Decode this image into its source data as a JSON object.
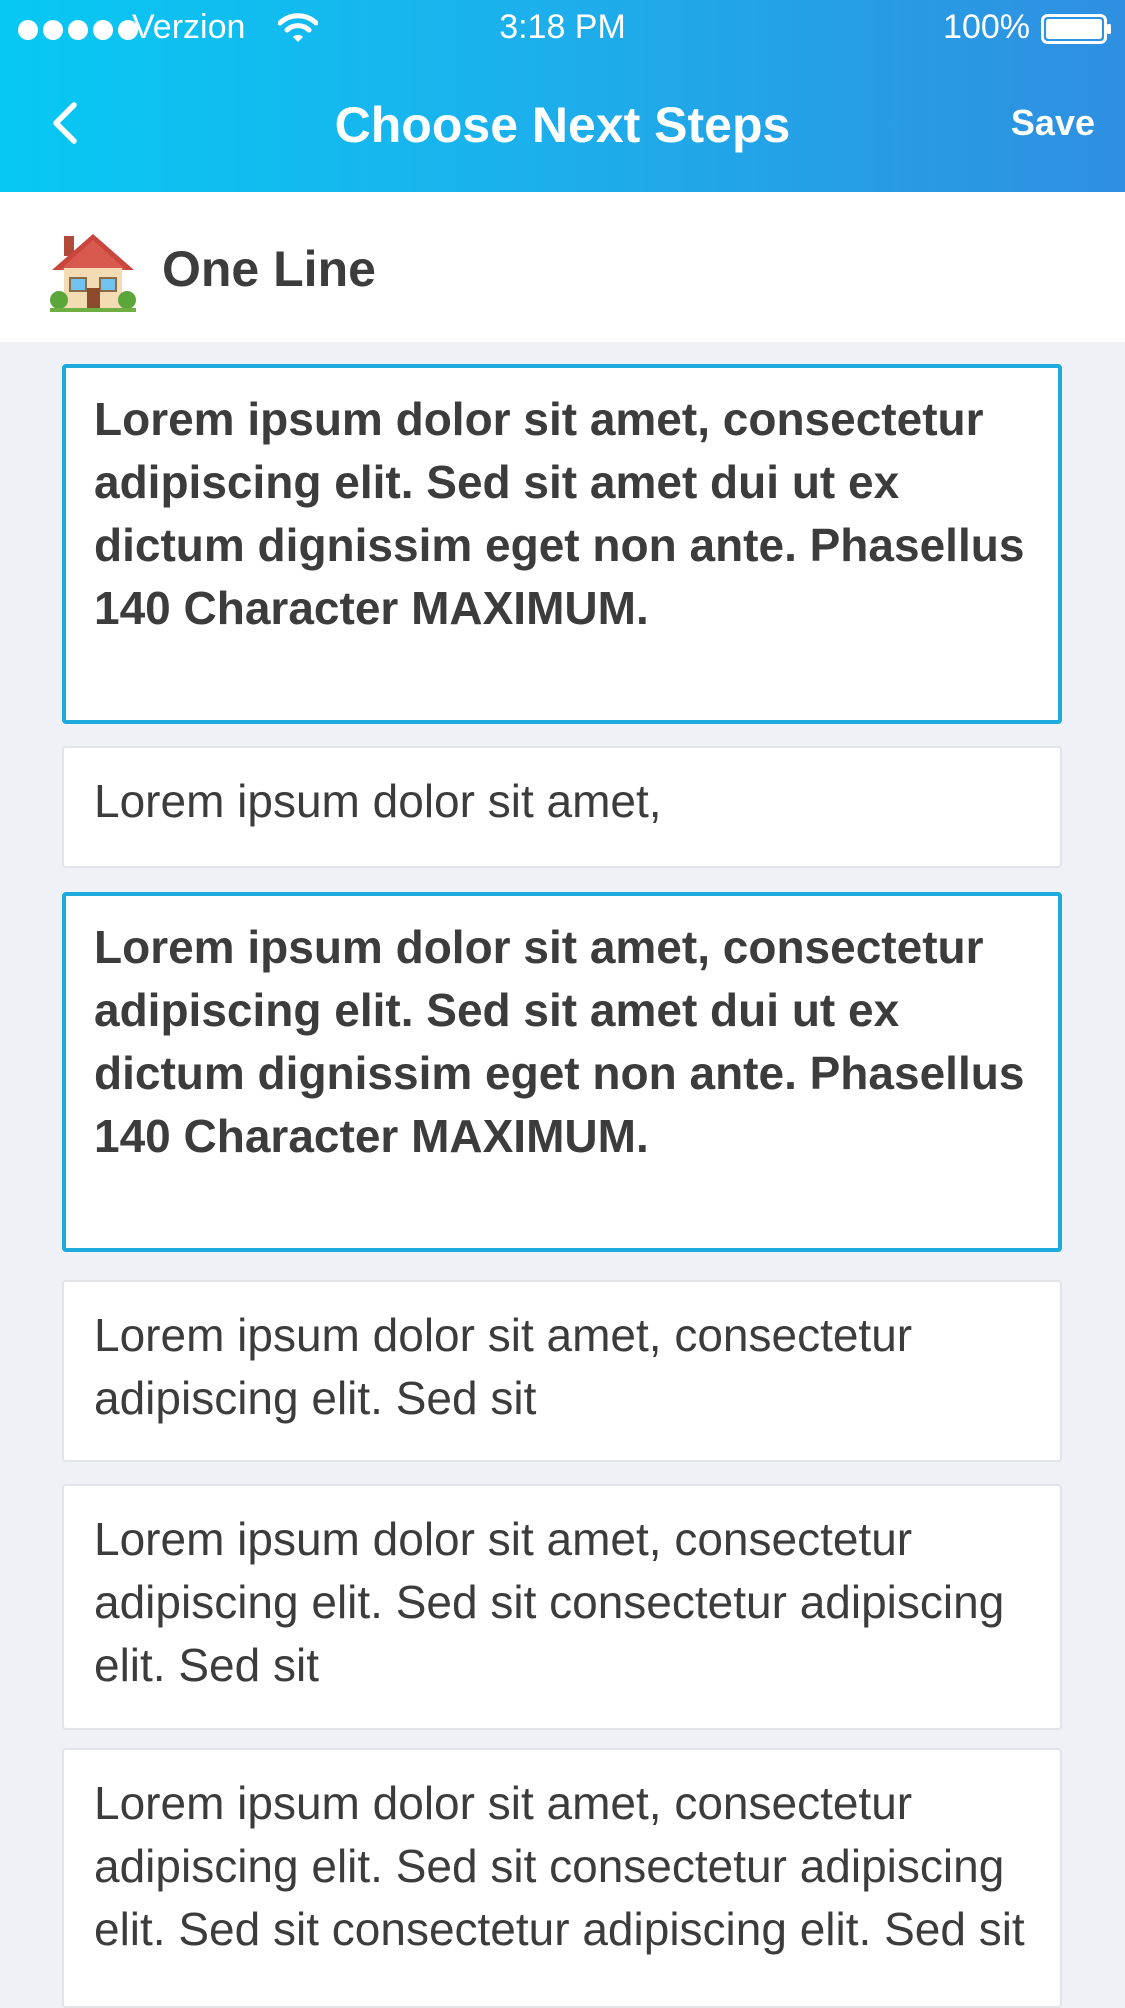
{
  "status_bar": {
    "carrier": "Verzion",
    "time": "3:18 PM",
    "battery": "100%"
  },
  "nav": {
    "title": "Choose Next Steps",
    "save_label": "Save",
    "back_icon": "chevron-left-icon"
  },
  "section": {
    "title": "One Line",
    "icon": "house-icon"
  },
  "colors": {
    "accent": "#1ea9dc",
    "header_start": "#07c8f3",
    "header_end": "#2f8fe0"
  },
  "cards": [
    {
      "text": "Lorem ipsum dolor sit amet, consectetur adipiscing elit. Sed sit amet dui ut ex dictum dignissim eget non ante. Phasellus 140 Character MAXIMUM.",
      "selected": true
    },
    {
      "text": "Lorem ipsum dolor sit amet,",
      "selected": false
    },
    {
      "text": "Lorem ipsum dolor sit amet, consectetur adipiscing elit. Sed sit amet dui ut ex dictum dignissim eget non ante. Phasellus 140 Character MAXIMUM.",
      "selected": true
    },
    {
      "text": "Lorem ipsum dolor sit amet, consectetur adipiscing elit. Sed sit",
      "selected": false
    },
    {
      "text": "Lorem ipsum dolor sit amet, consectetur adipiscing elit. Sed sit consectetur adipiscing elit. Sed sit",
      "selected": false
    },
    {
      "text": "Lorem ipsum dolor sit amet, consectetur adipiscing elit. Sed sit consectetur adipiscing elit. Sed sit consectetur adipiscing elit. Sed sit",
      "selected": false
    }
  ]
}
